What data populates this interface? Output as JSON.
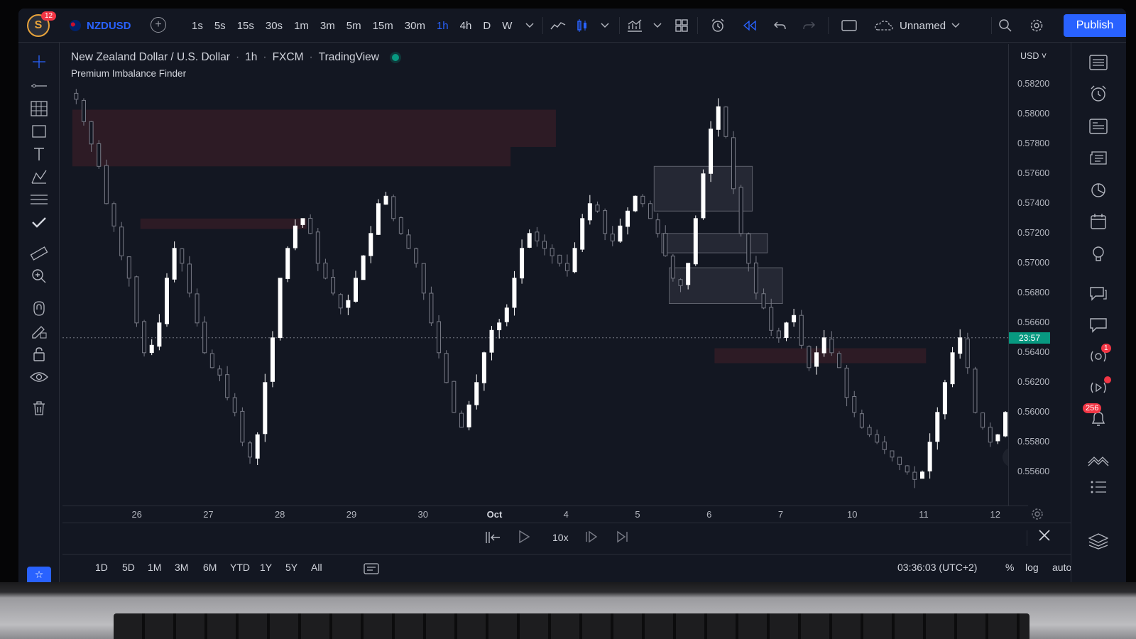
{
  "app": {
    "notification_count": "12",
    "symbol": "NZDUSD",
    "intervals": [
      "1s",
      "5s",
      "15s",
      "30s",
      "1m",
      "3m",
      "5m",
      "15m",
      "30m",
      "1h",
      "4h",
      "D",
      "W"
    ],
    "active_interval": "1h",
    "layout_name": "Unnamed",
    "publish_label": "Publish"
  },
  "chart": {
    "title_parts": {
      "pair": "New Zealand Dollar / U.S. Dollar",
      "interval": "1h",
      "source": "FXCM",
      "platform": "TradingView"
    },
    "indicator_name": "Premium Imbalance Finder",
    "currency": "USD",
    "price_labels": [
      "0.58200",
      "0.58000",
      "0.57800",
      "0.57600",
      "0.57400",
      "0.57200",
      "0.57000",
      "0.56800",
      "0.56600",
      "0.56400",
      "0.56200",
      "0.56000",
      "0.55800",
      "0.55600"
    ],
    "countdown": "23:57",
    "time_labels": [
      "26",
      "27",
      "28",
      "29",
      "30",
      "Oct",
      "4",
      "5",
      "6",
      "7",
      "10",
      "11",
      "12"
    ],
    "colors": {
      "up": "#ffffff",
      "down": "#787b86",
      "bearish_zone": "#f23645",
      "bullish_zone": "#9598a1",
      "accent": "#2962ff",
      "live": "#089981"
    }
  },
  "chart_data": {
    "type": "candlestick",
    "title": "New Zealand Dollar / U.S. Dollar · 1h · FXCM · TradingView",
    "x_label": "",
    "y_label": "",
    "ylim": [
      0.5548,
      0.5828
    ],
    "categories": [
      "26",
      "27",
      "28",
      "29",
      "30",
      "Oct",
      "4",
      "5",
      "6",
      "7",
      "10",
      "11",
      "12"
    ],
    "series": [
      {
        "values": [
          0.581,
          0.5795,
          0.578,
          0.5765,
          0.574,
          0.5725,
          0.5705,
          0.569,
          0.566,
          0.564,
          0.5645,
          0.566,
          0.569,
          0.571,
          0.57,
          0.568,
          0.566,
          0.564,
          0.563,
          0.5625,
          0.561,
          0.56,
          0.558,
          0.557,
          0.5585,
          0.562,
          0.565,
          0.569,
          0.571,
          0.5725,
          0.573,
          0.572,
          0.57,
          0.569,
          0.568,
          0.567,
          0.5675,
          0.569,
          0.5705,
          0.572,
          0.574,
          0.5745,
          0.573,
          0.572,
          0.571,
          0.57,
          0.568,
          0.566,
          0.564,
          0.562,
          0.56,
          0.559,
          0.5605,
          0.562,
          0.564,
          0.5655,
          0.566,
          0.567,
          0.569,
          0.571,
          0.572,
          0.5715,
          0.571,
          0.5705,
          0.57,
          0.5695,
          0.571,
          0.573,
          0.574,
          0.5735,
          0.572,
          0.5715,
          0.5725,
          0.5735,
          0.5745,
          0.574,
          0.573,
          0.572,
          0.5705,
          0.569,
          0.5685,
          0.57,
          0.573,
          0.576,
          0.579,
          0.5805,
          0.5785,
          0.575,
          0.572,
          0.57,
          0.568,
          0.567,
          0.5655,
          0.565,
          0.566,
          0.5665,
          0.5645,
          0.563,
          0.564,
          0.565,
          0.564,
          0.563,
          0.561,
          0.56,
          0.559,
          0.5585,
          0.558,
          0.5575,
          0.557,
          0.5565,
          0.556,
          0.5555,
          0.556,
          0.558,
          0.56,
          0.562,
          0.564,
          0.565,
          0.563,
          0.56,
          0.559,
          0.558,
          0.5585,
          0.56,
          0.559
        ]
      }
    ],
    "zones": [
      {
        "kind": "bearish",
        "from_index": 0,
        "to_index": 63,
        "top": 0.5803,
        "bottom": 0.5778
      },
      {
        "kind": "bearish",
        "from_index": 0,
        "to_index": 57,
        "top": 0.5778,
        "bottom": 0.5765
      },
      {
        "kind": "bearish",
        "from_index": 9,
        "to_index": 30,
        "top": 0.573,
        "bottom": 0.5723
      },
      {
        "kind": "bullish",
        "from_index": 77,
        "to_index": 89,
        "top": 0.5765,
        "bottom": 0.5735
      },
      {
        "kind": "bullish",
        "from_index": 78,
        "to_index": 91,
        "top": 0.572,
        "bottom": 0.5707
      },
      {
        "kind": "bullish",
        "from_index": 79,
        "to_index": 93,
        "top": 0.5697,
        "bottom": 0.5673
      },
      {
        "kind": "bearish",
        "from_index": 85,
        "to_index": 112,
        "top": 0.5643,
        "bottom": 0.5633
      }
    ],
    "last_price": 0.565
  },
  "replay": {
    "speed": "10x"
  },
  "bottom": {
    "ranges": [
      "1D",
      "5D",
      "1M",
      "3M",
      "6M",
      "YTD",
      "1Y",
      "5Y",
      "All"
    ],
    "clock": "03:36:03 (UTC+2)",
    "percent_label": "%",
    "log_label": "log",
    "auto_label": "auto"
  },
  "sidebar": {
    "badge_ideas": "1",
    "badge_notifications": "256"
  },
  "icons": [
    "logo-icon",
    "plus-icon",
    "indicators-icon",
    "bar-style-icon",
    "chart-type-icon",
    "layout-grid-icon",
    "alert-icon",
    "replay-icon",
    "undo-icon",
    "redo-icon",
    "fullscreen-icon",
    "cloud-icon",
    "search-icon",
    "settings-icon"
  ]
}
